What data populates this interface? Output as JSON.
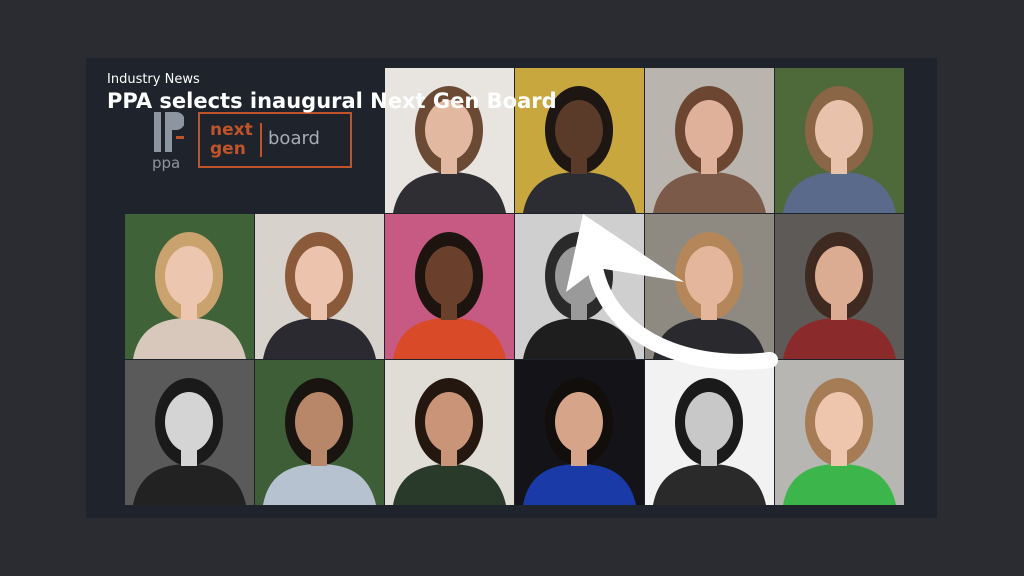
{
  "article": {
    "kicker": "Industry News",
    "headline": "PPA selects inaugural Next Gen Board"
  },
  "logo": {
    "ppa": "ppa",
    "next": "next",
    "gen": "gen",
    "board": "board",
    "accent_color": "#c0532a"
  },
  "photos": [
    {
      "bg": "#e8e5e0",
      "skin": "#e2b9a0",
      "hair": "#6b4a35",
      "shirt": "#2e2e33"
    },
    {
      "bg": "#c8a83e",
      "skin": "#5a3a28",
      "hair": "#1e1612",
      "shirt": "#2b2d33"
    },
    {
      "bg": "#b9b4ae",
      "skin": "#e0b19a",
      "hair": "#6d4632",
      "shirt": "#7b5a4a"
    },
    {
      "bg": "#4e6a3a",
      "skin": "#e9c2ac",
      "hair": "#8a6546",
      "shirt": "#5a6a8a"
    },
    {
      "bg": "#3f6238",
      "skin": "#ecc6ae",
      "hair": "#c9a26e",
      "shirt": "#d8c8bc"
    },
    {
      "bg": "#d7d2cb",
      "skin": "#ecc4ad",
      "hair": "#8a5a3a",
      "shirt": "#2a2a30"
    },
    {
      "bg": "#c75a82",
      "skin": "#6a3f2c",
      "hair": "#1d1410",
      "shirt": "#d84a28"
    },
    {
      "bg": "#cfcfcf",
      "skin": "#9a9a9a",
      "hair": "#2a2a2a",
      "shirt": "#1e1e1e"
    },
    {
      "bg": "#8e8a82",
      "skin": "#e4b79c",
      "hair": "#b4865a",
      "shirt": "#2a2a2e"
    },
    {
      "bg": "#5e5a58",
      "skin": "#dcac92",
      "hair": "#3e2a20",
      "shirt": "#8a2a2a"
    },
    {
      "bg": "#5a5a5a",
      "skin": "#d4d4d4",
      "hair": "#1a1a1a",
      "shirt": "#222222"
    },
    {
      "bg": "#3e5e38",
      "skin": "#b8876a",
      "hair": "#1a1410",
      "shirt": "#b7c2d0"
    },
    {
      "bg": "#e0dcd6",
      "skin": "#c99478",
      "hair": "#24170f",
      "shirt": "#2a3a2a"
    },
    {
      "bg": "#141418",
      "skin": "#d6a488",
      "hair": "#120e0c",
      "shirt": "#1a3aa8"
    },
    {
      "bg": "#f2f2f2",
      "skin": "#c8c8c8",
      "hair": "#1a1a1a",
      "shirt": "#2a2a2a"
    },
    {
      "bg": "#b8b6b2",
      "skin": "#eec6ae",
      "hair": "#a67c56",
      "shirt": "#3cb54a"
    }
  ]
}
